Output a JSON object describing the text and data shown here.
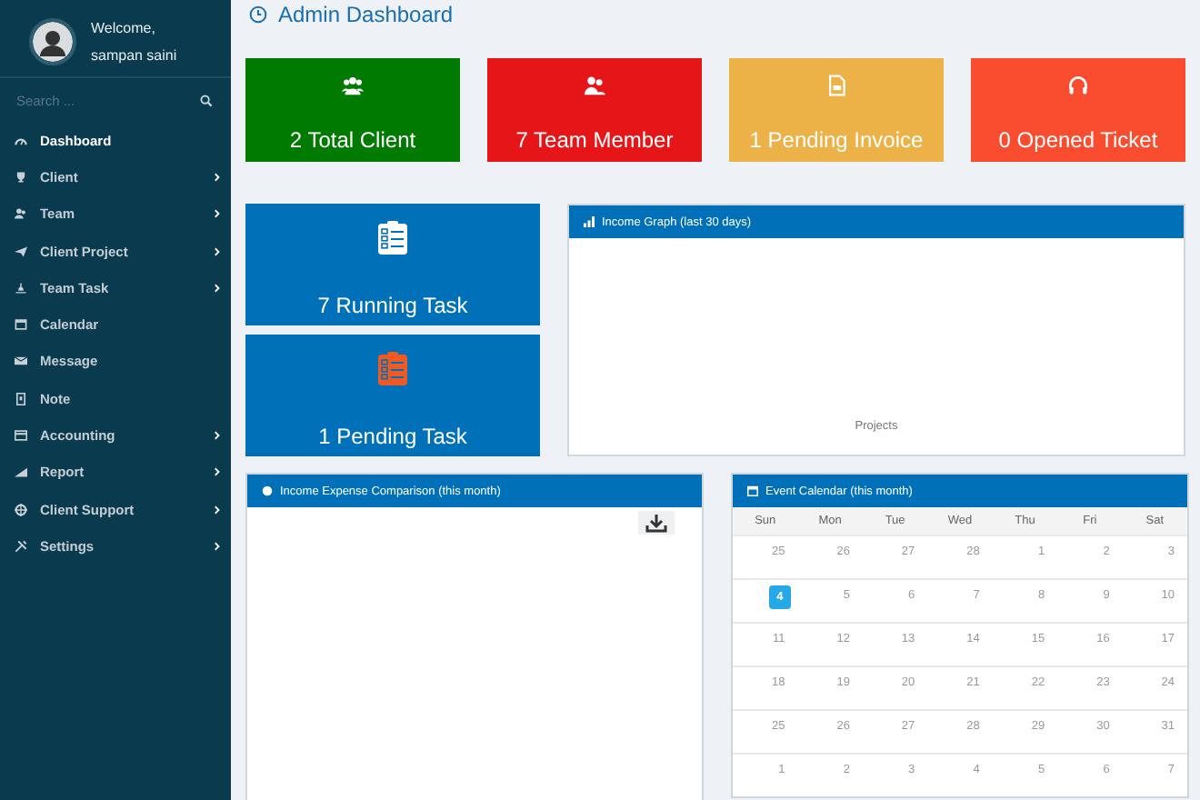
{
  "sidebar": {
    "welcome": "Welcome,",
    "user_name": "sampan saini",
    "search": {
      "placeholder": "Search ..."
    },
    "items": [
      {
        "label": "Dashboard",
        "selected": true,
        "has_submenu": false
      },
      {
        "label": "Client",
        "selected": false,
        "has_submenu": true
      },
      {
        "label": "Team",
        "selected": false,
        "has_submenu": true
      },
      {
        "label": "Client Project",
        "selected": false,
        "has_submenu": true
      },
      {
        "label": "Team Task",
        "selected": false,
        "has_submenu": true
      },
      {
        "label": "Calendar",
        "selected": false,
        "has_submenu": false
      },
      {
        "label": "Message",
        "selected": false,
        "has_submenu": false
      },
      {
        "label": "Note",
        "selected": false,
        "has_submenu": false
      },
      {
        "label": "Accounting",
        "selected": false,
        "has_submenu": true
      },
      {
        "label": "Report",
        "selected": false,
        "has_submenu": true
      },
      {
        "label": "Client Support",
        "selected": false,
        "has_submenu": true
      },
      {
        "label": "Settings",
        "selected": false,
        "has_submenu": true
      }
    ]
  },
  "page_title": "Admin Dashboard",
  "stats": [
    {
      "label": "2 Total Client",
      "color": "#007a00"
    },
    {
      "label": "7 Team Member",
      "color": "#e61618"
    },
    {
      "label": "1 Pending Invoice",
      "color": "#edb247"
    },
    {
      "label": "0 Opened Ticket",
      "color": "#fa4c2e"
    }
  ],
  "tasks": [
    {
      "label": "7 Running Task"
    },
    {
      "label": "1 Pending Task"
    }
  ],
  "income_graph": {
    "title": "Income Graph (last 30 days)",
    "legend": "Projects"
  },
  "income_expense": {
    "title": "Income Expense Comparison (this month)"
  },
  "calendar": {
    "title": "Event Calendar (this month)",
    "weekdays": [
      "Sun",
      "Mon",
      "Tue",
      "Wed",
      "Thu",
      "Fri",
      "Sat"
    ],
    "weeks": [
      [
        {
          "day": "25",
          "today": false
        },
        {
          "day": "26",
          "today": false
        },
        {
          "day": "27",
          "today": false
        },
        {
          "day": "28",
          "today": false
        },
        {
          "day": "1",
          "today": false
        },
        {
          "day": "2",
          "today": false
        },
        {
          "day": "3",
          "today": false
        }
      ],
      [
        {
          "day": "4",
          "today": true
        },
        {
          "day": "5",
          "today": false
        },
        {
          "day": "6",
          "today": false
        },
        {
          "day": "7",
          "today": false
        },
        {
          "day": "8",
          "today": false
        },
        {
          "day": "9",
          "today": false
        },
        {
          "day": "10",
          "today": false
        }
      ],
      [
        {
          "day": "11",
          "today": false
        },
        {
          "day": "12",
          "today": false
        },
        {
          "day": "13",
          "today": false
        },
        {
          "day": "14",
          "today": false
        },
        {
          "day": "15",
          "today": false
        },
        {
          "day": "16",
          "today": false
        },
        {
          "day": "17",
          "today": false
        }
      ],
      [
        {
          "day": "18",
          "today": false
        },
        {
          "day": "19",
          "today": false
        },
        {
          "day": "20",
          "today": false
        },
        {
          "day": "21",
          "today": false
        },
        {
          "day": "22",
          "today": false
        },
        {
          "day": "23",
          "today": false
        },
        {
          "day": "24",
          "today": false
        }
      ],
      [
        {
          "day": "25",
          "today": false
        },
        {
          "day": "26",
          "today": false
        },
        {
          "day": "27",
          "today": false
        },
        {
          "day": "28",
          "today": false
        },
        {
          "day": "29",
          "today": false
        },
        {
          "day": "30",
          "today": false
        },
        {
          "day": "31",
          "today": false
        }
      ],
      [
        {
          "day": "1",
          "today": false
        },
        {
          "day": "2",
          "today": false
        },
        {
          "day": "3",
          "today": false
        },
        {
          "day": "4",
          "today": false
        },
        {
          "day": "5",
          "today": false
        },
        {
          "day": "6",
          "today": false
        },
        {
          "day": "7",
          "today": false
        }
      ]
    ]
  }
}
